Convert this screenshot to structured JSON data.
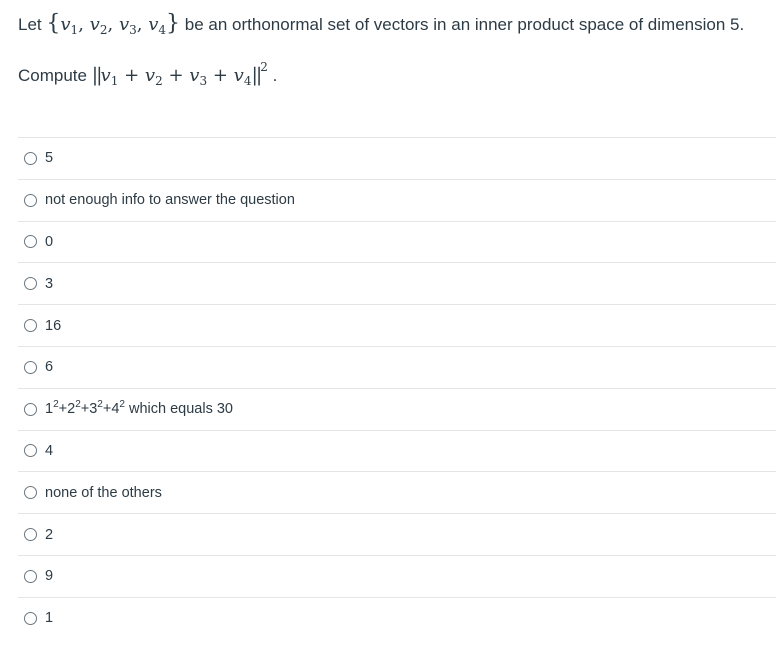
{
  "question": {
    "line1_prefix": "Let",
    "line1_suffix": "be an orthonormal set of vectors in an inner product space of dimension 5.",
    "line2_prefix": "Compute",
    "line2_suffix": ".",
    "set_open": "{",
    "set_close": "}",
    "vector_letter": "v",
    "subscripts": [
      "1",
      "2",
      "3",
      "4"
    ],
    "separator": ",",
    "plus": "+",
    "norm_bars": "||",
    "exponent": "2"
  },
  "answers": [
    {
      "label": "5",
      "selected": false
    },
    {
      "label": "not enough info to answer the question",
      "selected": false
    },
    {
      "label": "0",
      "selected": false
    },
    {
      "label": "3",
      "selected": false
    },
    {
      "label": "16",
      "selected": false
    },
    {
      "label": "6",
      "selected": false
    },
    {
      "label_parts": [
        "1",
        "2",
        "+2",
        "2",
        "+3",
        "2",
        "+4",
        "2",
        " which equals 30"
      ],
      "selected": false
    },
    {
      "label": "4",
      "selected": false
    },
    {
      "label": "none of the others",
      "selected": false
    },
    {
      "label": "2",
      "selected": false
    },
    {
      "label": "9",
      "selected": false
    },
    {
      "label": "1",
      "selected": false
    }
  ]
}
